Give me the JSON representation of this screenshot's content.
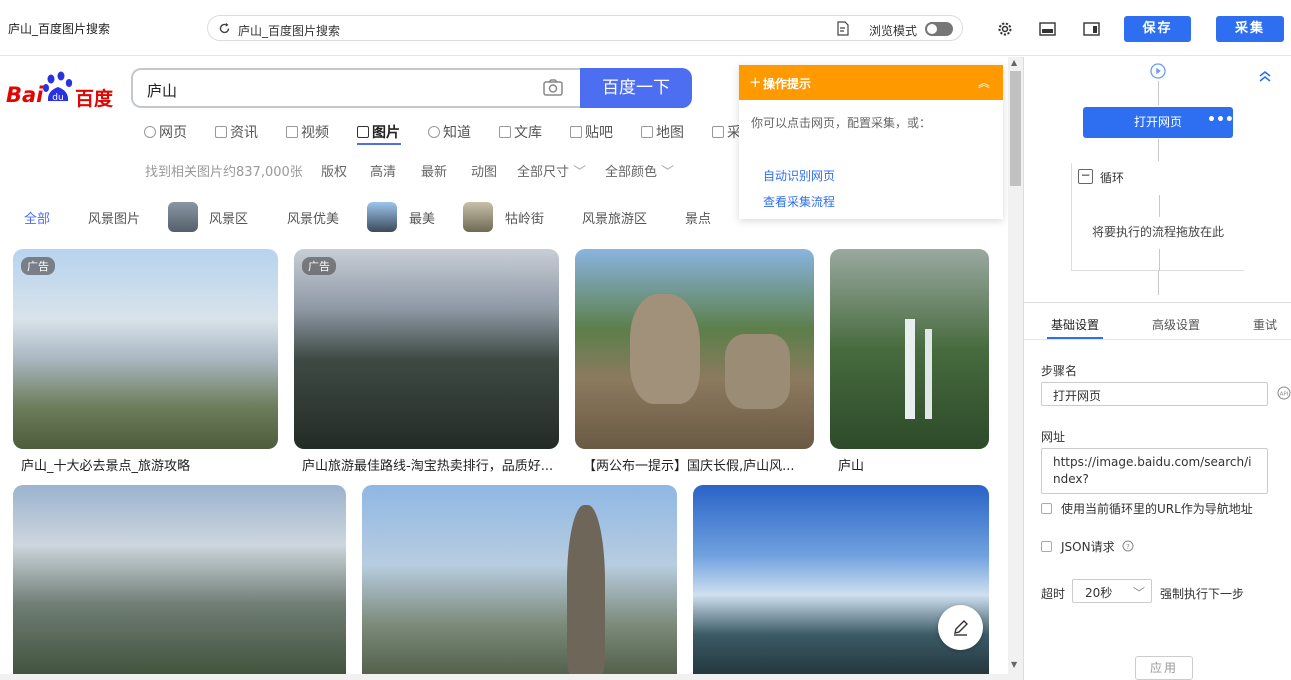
{
  "window": {
    "title": "庐山_百度图片搜索"
  },
  "urlbar": {
    "text": "庐山_百度图片搜索",
    "browse_mode_label": "浏览模式"
  },
  "toolbar": {
    "save_label": "保存",
    "collect_label": "采集"
  },
  "baidu": {
    "logo_text_1": "Bai",
    "logo_text_2": "百度",
    "search_value": "庐山",
    "search_button": "百度一下",
    "nav_tabs": [
      "网页",
      "资讯",
      "视频",
      "图片",
      "知道",
      "文库",
      "贴吧",
      "地图",
      "采"
    ],
    "active_tab": "图片",
    "result_count": "找到相关图片约837,000张",
    "filters": [
      "版权",
      "高清",
      "最新",
      "动图",
      "全部尺寸",
      "全部颜色"
    ],
    "categories": [
      "全部",
      "风景图片",
      "风景区",
      "风景优美",
      "最美",
      "牯岭街",
      "风景旅游区",
      "景点"
    ],
    "ad_label": "广告",
    "captions": [
      "庐山_十大必去景点_旅游攻略",
      "庐山旅游最佳路线-淘宝热卖排行，品质好...",
      "【两公布一提示】国庆长假,庐山风...",
      "庐山"
    ]
  },
  "tips": {
    "title": "操作提示",
    "desc": "你可以点击网页，配置采集，或：",
    "link1": "自动识别网页",
    "link2": "查看采集流程"
  },
  "flow": {
    "open_node": "打开网页",
    "loop_label": "循环",
    "drop_hint": "将要执行的流程拖放在此"
  },
  "settings": {
    "tabs": [
      "基础设置",
      "高级设置",
      "重试"
    ],
    "step_name_label": "步骤名",
    "step_name_value": "打开网页",
    "url_label": "网址",
    "url_value": "https://image.baidu.com/search/index?",
    "use_loop_url_label": "使用当前循环里的URL作为导航地址",
    "json_request_label": "JSON请求",
    "timeout_label": "超时",
    "timeout_value": "20秒",
    "force_next_label": "强制执行下一步",
    "apply_label": "应用"
  },
  "colors": {
    "accent": "#2d6ff0",
    "baidu_blue": "#4e6ef2",
    "tips_orange": "#ff9900"
  }
}
